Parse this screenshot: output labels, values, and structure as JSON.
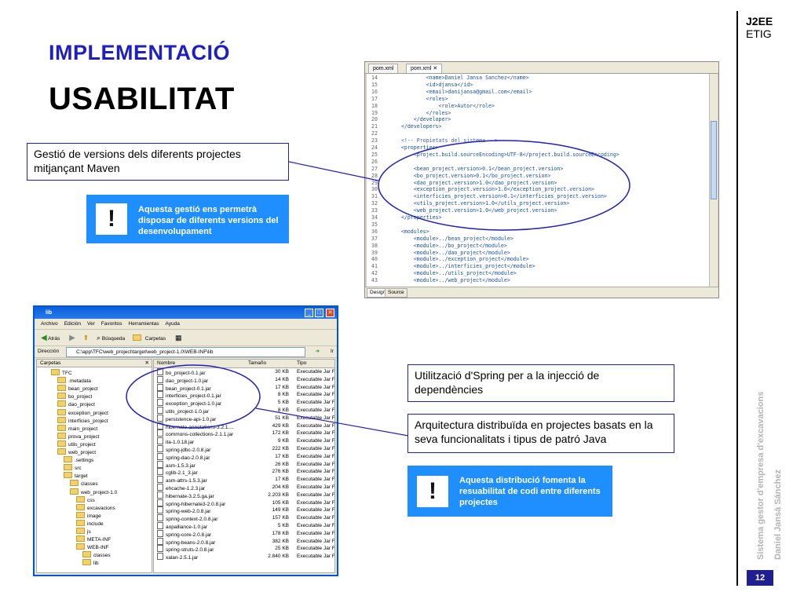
{
  "slide": {
    "title1": "IMPLEMENTACIÓ",
    "title2": "USABILITAT",
    "brand_line1": "J2EE",
    "brand_line2": "ETIG",
    "side_text1": "Sistema gestor d'empresa d'excavacions",
    "side_text2": "Daniel Jansà Sánchez",
    "page_number": "12",
    "accent_color": "#1f1fbf",
    "note_color": "#1f8fff"
  },
  "callouts": {
    "maven": "Gestió de versions dels diferents projectes mitjançant Maven",
    "spring": "Utilització d'Spring per a la injecció de dependències",
    "arch": "Arquitectura distribuïda en projectes basats en la seva funcionalitats i tipus de patró Java"
  },
  "notes": {
    "note1_symbol": "!",
    "note1": "Aquesta gestió ens permetrà disposar de diferents versions del desenvolupament",
    "note2_symbol": "!",
    "note2": "Aquesta distribució fomenta la resuabilitat de codi entre diferents projectes"
  },
  "editor": {
    "tab1": "pom.xml",
    "tab2": "pom.xml",
    "bottom_tab1": "Design",
    "bottom_tab2": "Source",
    "lines": [
      {
        "n": "14",
        "t": "            <name>Daniel Jansa Sanchez</name>"
      },
      {
        "n": "15",
        "t": "            <id>djansa</id>"
      },
      {
        "n": "16",
        "t": "            <email>danijansa@gmail.com</email>"
      },
      {
        "n": "17",
        "t": "            <roles>"
      },
      {
        "n": "18",
        "t": "                <role>Autor</role>"
      },
      {
        "n": "19",
        "t": "            </roles>"
      },
      {
        "n": "20",
        "t": "        </developer>"
      },
      {
        "n": "21",
        "t": "    </developers>"
      },
      {
        "n": "22",
        "t": ""
      },
      {
        "n": "23",
        "t": "    <!-- Propietats del sistema -->"
      },
      {
        "n": "24",
        "t": "    <properties>"
      },
      {
        "n": "25",
        "t": "        <project.build.sourceEncoding>UTF-8</project.build.sourceEncoding>"
      },
      {
        "n": "26",
        "t": ""
      },
      {
        "n": "27",
        "t": "        <bean_project.version>0.1</bean_project.version>"
      },
      {
        "n": "28",
        "t": "        <bo_project.version>0.1</bo_project.version>"
      },
      {
        "n": "29",
        "t": "        <dao_project.version>1.0</dao_project.version>"
      },
      {
        "n": "30",
        "t": "        <exception_project.version>1.0</exception_project.version>"
      },
      {
        "n": "31",
        "t": "        <interficies_project.version>0.1</interficies_project.version>"
      },
      {
        "n": "32",
        "t": "        <utils_project.version>1.0</utils_project.version>"
      },
      {
        "n": "33",
        "t": "        <web_project.version>1.0</web_project.version>"
      },
      {
        "n": "34",
        "t": "    </properties>"
      },
      {
        "n": "35",
        "t": ""
      },
      {
        "n": "36",
        "t": "    <modules>"
      },
      {
        "n": "37",
        "t": "        <module>../bean_project</module>"
      },
      {
        "n": "38",
        "t": "        <module>../bo_project</module>"
      },
      {
        "n": "39",
        "t": "        <module>../dao_project</module>"
      },
      {
        "n": "40",
        "t": "        <module>../exception_project</module>"
      },
      {
        "n": "41",
        "t": "        <module>../interficies_project</module>"
      },
      {
        "n": "42",
        "t": "        <module>../utils_project</module>"
      },
      {
        "n": "43",
        "t": "        <module>../web_project</module>"
      }
    ]
  },
  "explorer": {
    "title": "lib",
    "menu": [
      "Archivo",
      "Edición",
      "Ver",
      "Favoritos",
      "Herramientas",
      "Ayuda"
    ],
    "back_label": "Atrás",
    "search_label": "Búsqueda",
    "folders_label": "Carpetas",
    "address_label": "Dirección",
    "address": "C:\\app\\TFC\\web_project\\target\\web_project-1.0\\WEB-INF\\lib",
    "go_label": "Ir",
    "folders_header": "Carpetas",
    "tree": [
      {
        "label": "TFC",
        "d": 1
      },
      {
        "label": ".metadata",
        "d": 2
      },
      {
        "label": "bean_project",
        "d": 2
      },
      {
        "label": "bo_project",
        "d": 2
      },
      {
        "label": "dao_project",
        "d": 2
      },
      {
        "label": "exception_project",
        "d": 2
      },
      {
        "label": "interficies_project",
        "d": 2
      },
      {
        "label": "main_project",
        "d": 2
      },
      {
        "label": "prova_project",
        "d": 2
      },
      {
        "label": "utils_project",
        "d": 2
      },
      {
        "label": "web_project",
        "d": 2
      },
      {
        "label": ".settings",
        "d": 3
      },
      {
        "label": "src",
        "d": 3
      },
      {
        "label": "target",
        "d": 3
      },
      {
        "label": "classes",
        "d": 4
      },
      {
        "label": "web_project-1.0",
        "d": 4
      },
      {
        "label": "css",
        "d": 5
      },
      {
        "label": "excavacions",
        "d": 5
      },
      {
        "label": "image",
        "d": 5
      },
      {
        "label": "include",
        "d": 5
      },
      {
        "label": "js",
        "d": 5
      },
      {
        "label": "META-INF",
        "d": 5
      },
      {
        "label": "WEB-INF",
        "d": 5
      },
      {
        "label": "classes",
        "d": 6
      },
      {
        "label": "lib",
        "d": 6
      }
    ],
    "columns": [
      "Nombre",
      "Tamaño",
      "Tipo"
    ],
    "files": [
      {
        "name": "bo_project-0.1.jar",
        "size": "30 KB",
        "type": "Executable Jar File"
      },
      {
        "name": "dao_project-1.0.jar",
        "size": "14 KB",
        "type": "Executable Jar File"
      },
      {
        "name": "bean_project-0.1.jar",
        "size": "17 KB",
        "type": "Executable Jar File"
      },
      {
        "name": "interficies_project-0.1.jar",
        "size": "8 KB",
        "type": "Executable Jar File"
      },
      {
        "name": "exception_project-1.0.jar",
        "size": "5 KB",
        "type": "Executable Jar File"
      },
      {
        "name": "utils_project-1.0.jar",
        "size": "8 KB",
        "type": "Executable Jar File"
      },
      {
        "name": "persistence-api-1.0.jar",
        "size": "51 KB",
        "type": "Executable Jar File"
      },
      {
        "name": "hibernate-annotations-3.2.1....",
        "size": "429 KB",
        "type": "Executable Jar File"
      },
      {
        "name": "commons-collections-2.1.1.jar",
        "size": "172 KB",
        "type": "Executable Jar File"
      },
      {
        "name": "ita-1.0.18.jar",
        "size": "9 KB",
        "type": "Executable Jar File"
      },
      {
        "name": "spring-jdbc-2.0.8.jar",
        "size": "222 KB",
        "type": "Executable Jar File"
      },
      {
        "name": "spring-dao-2.0.8.jar",
        "size": "17 KB",
        "type": "Executable Jar File"
      },
      {
        "name": "asm-1.5.3.jar",
        "size": "26 KB",
        "type": "Executable Jar File"
      },
      {
        "name": "cglib-2.1_3.jar",
        "size": "276 KB",
        "type": "Executable Jar File"
      },
      {
        "name": "asm-attrs-1.5.3.jar",
        "size": "17 KB",
        "type": "Executable Jar File"
      },
      {
        "name": "ehcache-1.2.3.jar",
        "size": "204 KB",
        "type": "Executable Jar File"
      },
      {
        "name": "hibernate-3.2.5.ga.jar",
        "size": "2.203 KB",
        "type": "Executable Jar File"
      },
      {
        "name": "spring-hibernate3-2.0.8.jar",
        "size": "105 KB",
        "type": "Executable Jar File"
      },
      {
        "name": "spring-web-2.0.8.jar",
        "size": "149 KB",
        "type": "Executable Jar File"
      },
      {
        "name": "spring-context-2.0.8.jar",
        "size": "157 KB",
        "type": "Executable Jar File"
      },
      {
        "name": "aopalliance-1.0.jar",
        "size": "5 KB",
        "type": "Executable Jar File"
      },
      {
        "name": "spring-core-2.0.8.jar",
        "size": "178 KB",
        "type": "Executable Jar File"
      },
      {
        "name": "spring-beans-2.0.8.jar",
        "size": "382 KB",
        "type": "Executable Jar File"
      },
      {
        "name": "spring-struts-2.0.8.jar",
        "size": "25 KB",
        "type": "Executable Jar File"
      },
      {
        "name": "xalan-2.5.1.jar",
        "size": "2.840 KB",
        "type": "Executable Jar File"
      },
      {
        "name": "",
        "size": "",
        "type": ""
      }
    ]
  }
}
